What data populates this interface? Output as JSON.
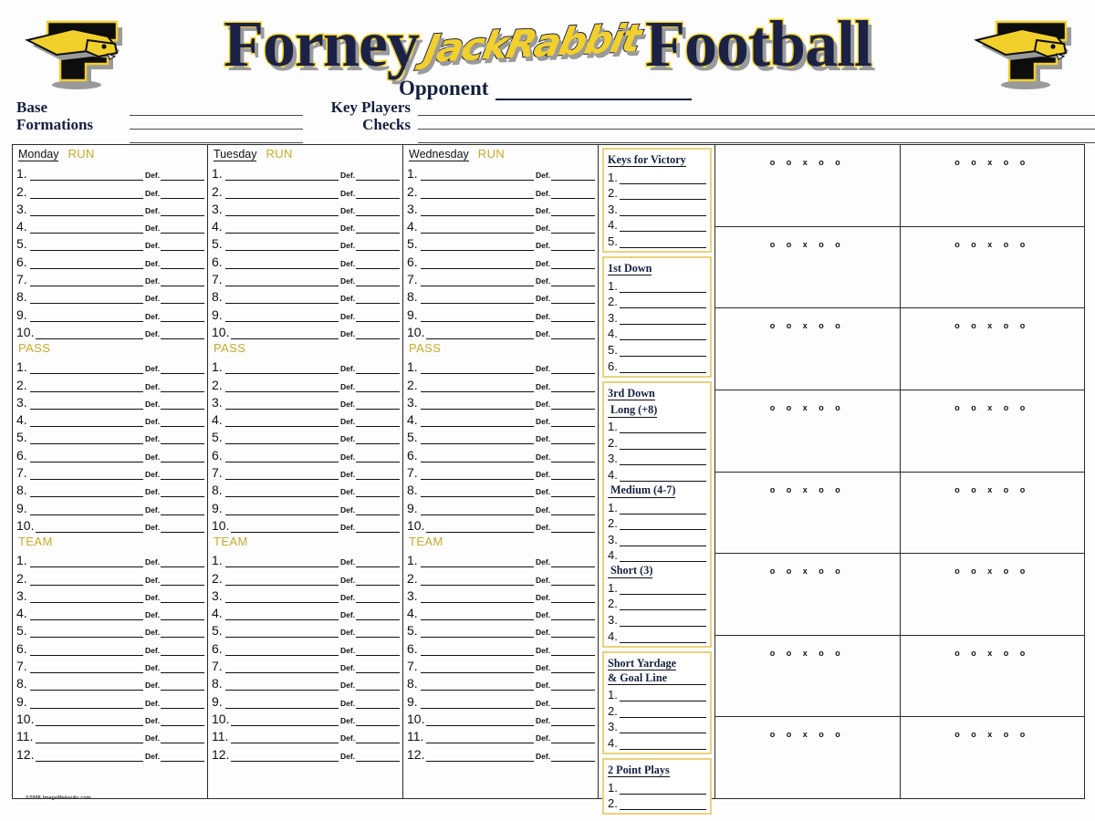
{
  "header": {
    "team_name": "Forney",
    "mascot_script": "JackRabbit",
    "sport": "Football",
    "opponent_label": "Opponent",
    "logo_letter": "F",
    "base_formations_label_line1": "Base",
    "base_formations_label_line2": "Formations",
    "key_players_label_line1": "Key Players",
    "key_players_label_line2": "Checks",
    "base_formations_lines": 3,
    "key_players_lines": 3
  },
  "colors": {
    "navy": "#1b2246",
    "gold": "#f2d02c",
    "muted_gold": "#c4ab2e",
    "box_gold": "#e8d37a",
    "shadow_gray": "#9a9a9a",
    "ink": "#111111"
  },
  "days": [
    {
      "name": "Monday",
      "sections": [
        {
          "label": "RUN",
          "count": 10
        },
        {
          "label": "PASS",
          "count": 10
        },
        {
          "label": "TEAM",
          "count": 12
        }
      ]
    },
    {
      "name": "Tuesday",
      "sections": [
        {
          "label": "RUN",
          "count": 10
        },
        {
          "label": "PASS",
          "count": 10
        },
        {
          "label": "TEAM",
          "count": 12
        }
      ]
    },
    {
      "name": "Wednesday",
      "sections": [
        {
          "label": "RUN",
          "count": 10
        },
        {
          "label": "PASS",
          "count": 10
        },
        {
          "label": "TEAM",
          "count": 12
        }
      ]
    }
  ],
  "def_label": "Def.",
  "keys_panel": [
    {
      "title": "Keys for Victory",
      "subsections": [
        {
          "label": null,
          "count": 5
        }
      ]
    },
    {
      "title": "1st Down",
      "subsections": [
        {
          "label": null,
          "count": 6
        }
      ]
    },
    {
      "title": "3rd Down",
      "subsections": [
        {
          "label": "Long (+8)",
          "count": 4
        },
        {
          "label": "Medium (4-7)",
          "count": 4
        },
        {
          "label": "Short (3)",
          "count": 4
        }
      ]
    },
    {
      "title": "Short Yardage",
      "title_line2": "& Goal Line",
      "subsections": [
        {
          "label": null,
          "count": 4
        }
      ]
    },
    {
      "title": "2 Point Plays",
      "subsections": [
        {
          "label": null,
          "count": 2
        }
      ]
    }
  ],
  "diagram_grid": {
    "rows": 8,
    "cols": 2,
    "formation_marks": "o  o  x  o  o"
  },
  "footer": {
    "copyright": "©2006 ImageMaker4u.com"
  }
}
